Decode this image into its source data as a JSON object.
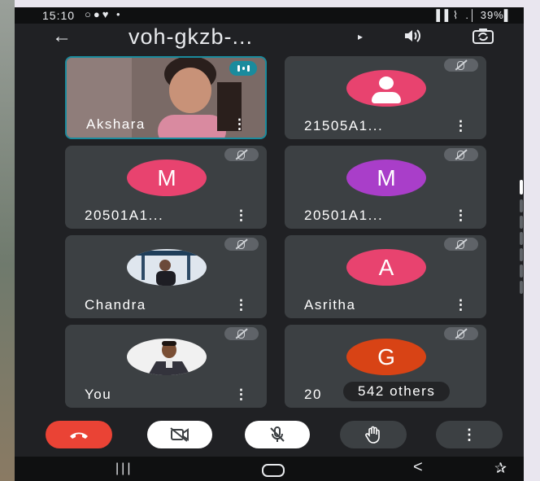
{
  "status_bar": {
    "time": "15:10",
    "left_icons": "○●♥ •",
    "right_text": "▐▐ ⌇  .│ 39%▌"
  },
  "top_bar": {
    "title": "voh-gkzb-...",
    "cast_arrow": "▸"
  },
  "tiles": [
    {
      "name": "Akshara",
      "more": "⋮",
      "speaking": true,
      "muted": false
    },
    {
      "name": "21505A1...",
      "more": "⋮",
      "avatar": "person-icon",
      "avatar_color": "#e8436f",
      "muted": true
    },
    {
      "name": "20501A1...",
      "more": "⋮",
      "initial": "M",
      "avatar_color": "#e8436f",
      "muted": true
    },
    {
      "name": "20501A1...",
      "more": "⋮",
      "initial": "M",
      "avatar_color": "#a93ec9",
      "muted": true
    },
    {
      "name": "Chandra",
      "more": "⋮",
      "avatar": "photo",
      "muted": true
    },
    {
      "name": "Asritha",
      "more": "⋮",
      "initial": "A",
      "avatar_color": "#e8436f",
      "muted": true
    },
    {
      "name": "You",
      "more": "⋮",
      "avatar": "photo",
      "muted": true
    },
    {
      "name": "20",
      "more": "",
      "initial": "G",
      "avatar_color": "#d84315",
      "muted": true,
      "others_label": "542 others"
    }
  ],
  "controls": {
    "end_call": "end-call-icon",
    "camera": "camera-off-icon",
    "mic": "mic-off-icon",
    "hand": "raise-hand-icon",
    "more": "⋮"
  },
  "nav_bar": {
    "recent": "|||",
    "back": "<",
    "accessibility": "✰"
  },
  "colors": {
    "background": "#202124",
    "tile": "#3c4043",
    "active_border": "#1a8b9d",
    "end_call": "#ea4335"
  }
}
